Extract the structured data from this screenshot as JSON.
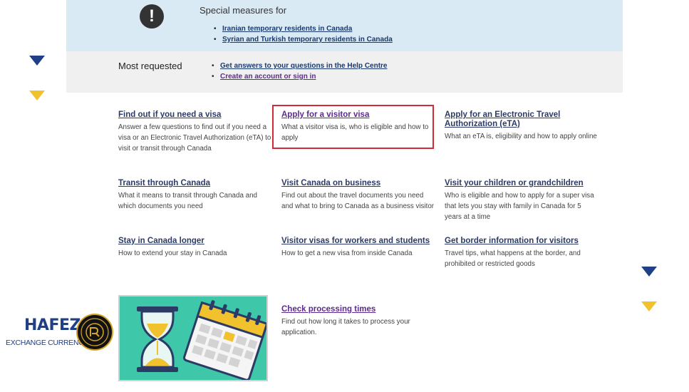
{
  "alert": {
    "icon": "exclamation-icon",
    "icon_glyph": "!",
    "title": "Special measures for",
    "links": [
      "Iranian temporary residents in Canada",
      "Syrian and Turkish temporary residents in Canada"
    ]
  },
  "requested": {
    "title": "Most requested",
    "links": [
      "Get answers to your questions in the Help Centre",
      "Create an account or sign in"
    ]
  },
  "cards": [
    {
      "title": "Find out if you need a visa",
      "desc": "Answer a few questions to find out if you need a visa or an Electronic Travel Authorization (eTA) to visit or transit through Canada"
    },
    {
      "title": "Apply for a visitor visa",
      "desc": "What a visitor visa is, who is eligible and how to apply"
    },
    {
      "title": "Apply for an Electronic Travel Authorization (eTA)",
      "desc": "What an eTA is, eligibility and how to apply online"
    },
    {
      "title": "Transit through Canada",
      "desc": "What it means to transit through Canada and which documents you need"
    },
    {
      "title": "Visit Canada on business",
      "desc": "Find out about the travel documents you need and what to bring to Canada as a business visitor"
    },
    {
      "title": "Visit your children or grandchildren",
      "desc": "Who is eligible and how to apply for a super visa that lets you stay with family in Canada for 5 years at a time"
    },
    {
      "title": "Stay in Canada longer",
      "desc": "How to extend your stay in Canada"
    },
    {
      "title": "Visitor visas for workers and students",
      "desc": "How to get a new visa from inside Canada"
    },
    {
      "title": "Get border information for visitors",
      "desc": "Travel tips, what happens at the border, and prohibited or restricted goods"
    },
    {
      "title": "Check processing times",
      "desc": "Find out how long it takes to process your application."
    }
  ],
  "logo": {
    "brand": "HAFEZ",
    "tagline": "EXCHANGE CURRENCY",
    "seal_text": "HAFEZ EXCHANGE"
  },
  "colors": {
    "alert_bg": "#d9eaf5",
    "requested_bg": "#f0f0f0",
    "link": "#2b3b66",
    "visited_link": "#5d2a8f",
    "highlight": "#d12b3a",
    "brand_blue": "#1f3f86",
    "brand_yellow": "#f2c12e"
  }
}
